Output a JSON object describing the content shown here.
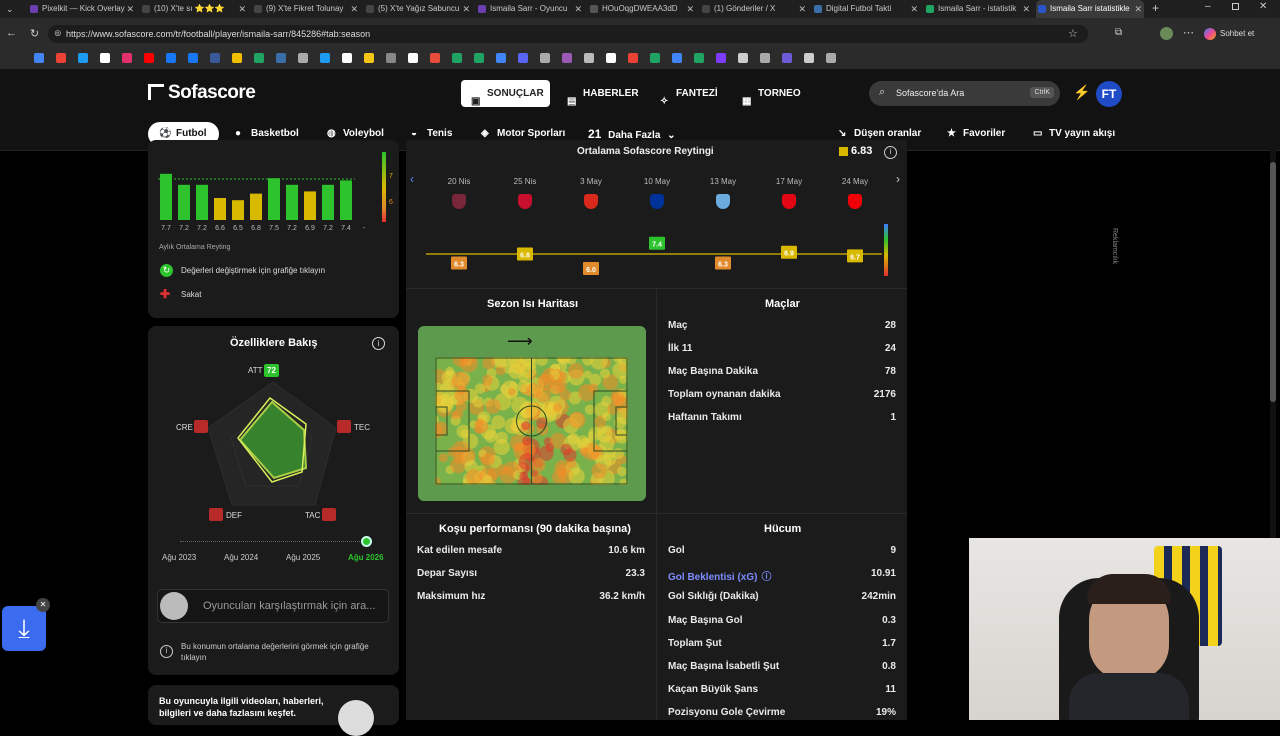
{
  "browser": {
    "tabs": [
      {
        "title": "Pixelkit — Kick Overlay"
      },
      {
        "title": "(10) X'te sı ⭐⭐⭐"
      },
      {
        "title": "(9) X'te Fikret Tolunay"
      },
      {
        "title": "(5) X'te Yağız Sabuncu"
      },
      {
        "title": "Ismaila Sarr - Oyuncu"
      },
      {
        "title": "HOuOqgDWEAA3dD"
      },
      {
        "title": "(1) Gönderiler / X"
      },
      {
        "title": "Digital Futbol Takti"
      },
      {
        "title": "Ismaila Sarr - istatistik"
      },
      {
        "title": "Ismaila Sarr istatistikle"
      }
    ],
    "url": "https://www.sofascore.com/tr/football/player/ismaila-sarr/845286#tab:season",
    "sohbet_label": "Sohbet et"
  },
  "header": {
    "logo": "Sofascore",
    "nav": [
      "SONUÇLAR",
      "HABERLER",
      "FANTEZİ",
      "TORNEO"
    ],
    "search_placeholder": "Sofascore'da Ara",
    "search_shortcut": "CtrlK",
    "avatar_initials": "FT",
    "sports": [
      "Futbol",
      "Basketbol",
      "Voleybol",
      "Tenis",
      "Motor Sporları"
    ],
    "more_count": "21",
    "more_label": "Daha Fazla",
    "right_links": [
      "Düşen oranlar",
      "Favoriler",
      "TV yayın akışı"
    ]
  },
  "monthly": {
    "bars": [
      7.7,
      7.2,
      7.2,
      6.6,
      6.5,
      6.8,
      7.5,
      7.2,
      6.9,
      7.2,
      7.4
    ],
    "labels": [
      "7.7",
      "7.2",
      "7.2",
      "6.6",
      "6.5",
      "6.8",
      "7.5",
      "7.2",
      "6.9",
      "7.2",
      "7.4",
      "-"
    ],
    "scale_labels": [
      "7",
      "6"
    ],
    "caption": "Aylık Ortalama Reyting",
    "hint": "Değerleri değiştirmek için grafiğe tıklayın",
    "injury": "Sakat"
  },
  "attributes": {
    "title": "Özelliklere Bakış",
    "labels": {
      "att": "ATT",
      "tec": "TEC",
      "tac": "TAC",
      "def": "DEF",
      "cre": "CRE"
    },
    "values": {
      "att": "72",
      "tec": "",
      "tac": "",
      "def": "",
      "cre": ""
    },
    "years": [
      "Ağu 2023",
      "Ağu 2024",
      "Ağu 2025",
      "Ağu 2026"
    ],
    "compare_placeholder": "Oyuncuları karşılaştırmak için ara...",
    "position_hint": "Bu konumun ortalama değerlerini görmek için grafiğe tıklayın",
    "promo": "Bu oyuncuyla ilgili videoları, haberleri, bilgileri ve daha fazlasını keşfet."
  },
  "rating": {
    "title": "Ortalama Sofascore Reytingi",
    "avg": "6.83",
    "dates": [
      "20 Nis",
      "25 Nis",
      "3 May",
      "10 May",
      "13 May",
      "17 May",
      "24 May"
    ],
    "values": [
      6.3,
      6.8,
      6.0,
      7.4,
      6.3,
      6.9,
      6.7
    ],
    "value_labels": [
      "6.3",
      "6.8",
      "6.0",
      "7.4",
      "6.3",
      "6.9",
      "6.7"
    ],
    "team_colors": [
      "#7a263a",
      "#c8102e",
      "#da291c",
      "#003399",
      "#6cabdd",
      "#e30613",
      "#ef0107"
    ]
  },
  "heatmap": {
    "title": "Sezon Isı Haritası"
  },
  "matches": {
    "title": "Maçlar",
    "rows": [
      {
        "label": "Maç",
        "value": "28"
      },
      {
        "label": "İlk 11",
        "value": "24"
      },
      {
        "label": "Maç Başına Dakika",
        "value": "78"
      },
      {
        "label": "Toplam oynanan dakika",
        "value": "2176"
      },
      {
        "label": "Haftanın Takımı",
        "value": "1"
      }
    ]
  },
  "running": {
    "title": "Koşu performansı (90 dakika başına)",
    "rows": [
      {
        "label": "Kat edilen mesafe",
        "value": "10.6 km"
      },
      {
        "label": "Depar Sayısı",
        "value": "23.3"
      },
      {
        "label": "Maksimum hız",
        "value": "36.2 km/h"
      }
    ]
  },
  "attack": {
    "title": "Hücum",
    "rows": [
      {
        "label": "Gol",
        "value": "9"
      },
      {
        "label": "Gol Beklentisi (xG)",
        "value": "10.91"
      },
      {
        "label": "Gol Sıklığı (Dakika)",
        "value": "242min"
      },
      {
        "label": "Maç Başına Gol",
        "value": "0.3"
      },
      {
        "label": "Toplam Şut",
        "value": "1.7"
      },
      {
        "label": "Maç Başına İsabetli Şut",
        "value": "0.8"
      },
      {
        "label": "Kaçan Büyük Şans",
        "value": "11"
      },
      {
        "label": "Pozisyonu Gole Çevirme",
        "value": "19%"
      }
    ]
  },
  "ad_label": "Reklamcılık",
  "colors": {
    "accent": "#2cc32c",
    "yellow": "#d9b800",
    "orange": "#e08a2b",
    "red": "#e03030",
    "blue": "#3d7cff"
  }
}
